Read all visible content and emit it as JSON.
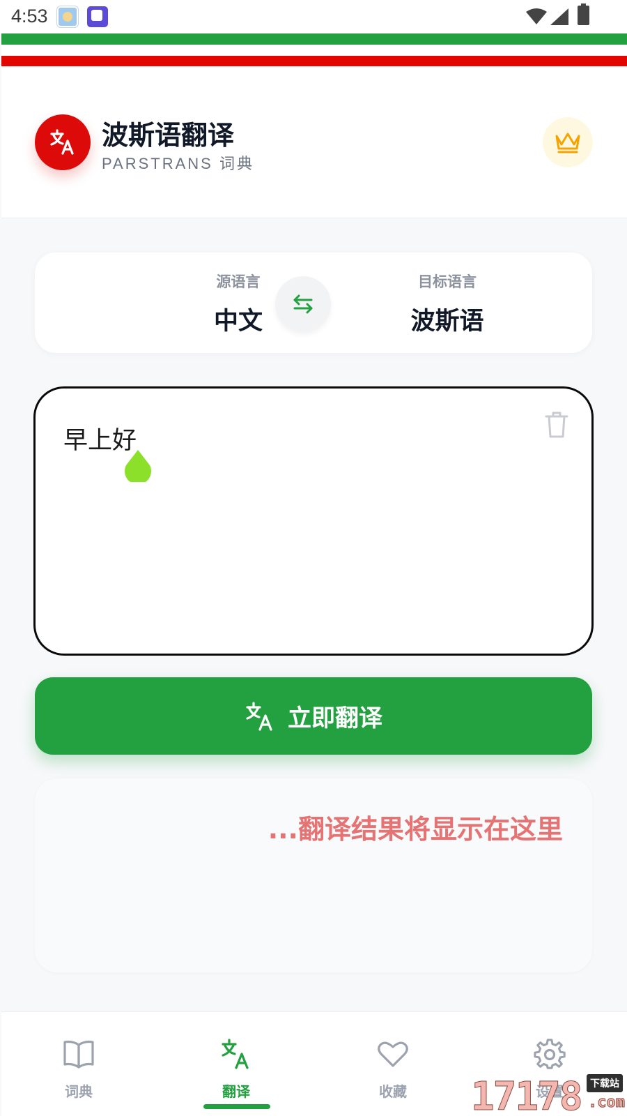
{
  "status_bar": {
    "time": "4:53"
  },
  "header": {
    "title": "波斯语翻译",
    "subtitle": "PARSTRANS 词典",
    "logo_icon": "translate-icon",
    "premium_icon": "crown-icon"
  },
  "languages": {
    "source_caption": "源语言",
    "source_value": "中文",
    "target_caption": "目标语言",
    "target_value": "波斯语",
    "swap_icon": "swap-icon"
  },
  "input": {
    "text": "早上好",
    "clear_icon": "trash-icon"
  },
  "translate_button": {
    "label": "立即翻译"
  },
  "result": {
    "placeholder": "...翻译结果将显示在这里"
  },
  "bottom_nav": {
    "items": [
      {
        "label": "词典",
        "icon": "book-icon",
        "active": false
      },
      {
        "label": "翻译",
        "icon": "translate-icon",
        "active": true
      },
      {
        "label": "收藏",
        "icon": "heart-icon",
        "active": false
      },
      {
        "label": "设置",
        "icon": "gear-icon",
        "active": false
      }
    ]
  },
  "watermark": {
    "number": "17178",
    "badge": "下载站",
    "suffix": ".com"
  },
  "colors": {
    "brand_green": "#23a03f",
    "brand_red": "#dd0a0a",
    "result_placeholder": "#e57373",
    "crown": "#f5a300"
  }
}
